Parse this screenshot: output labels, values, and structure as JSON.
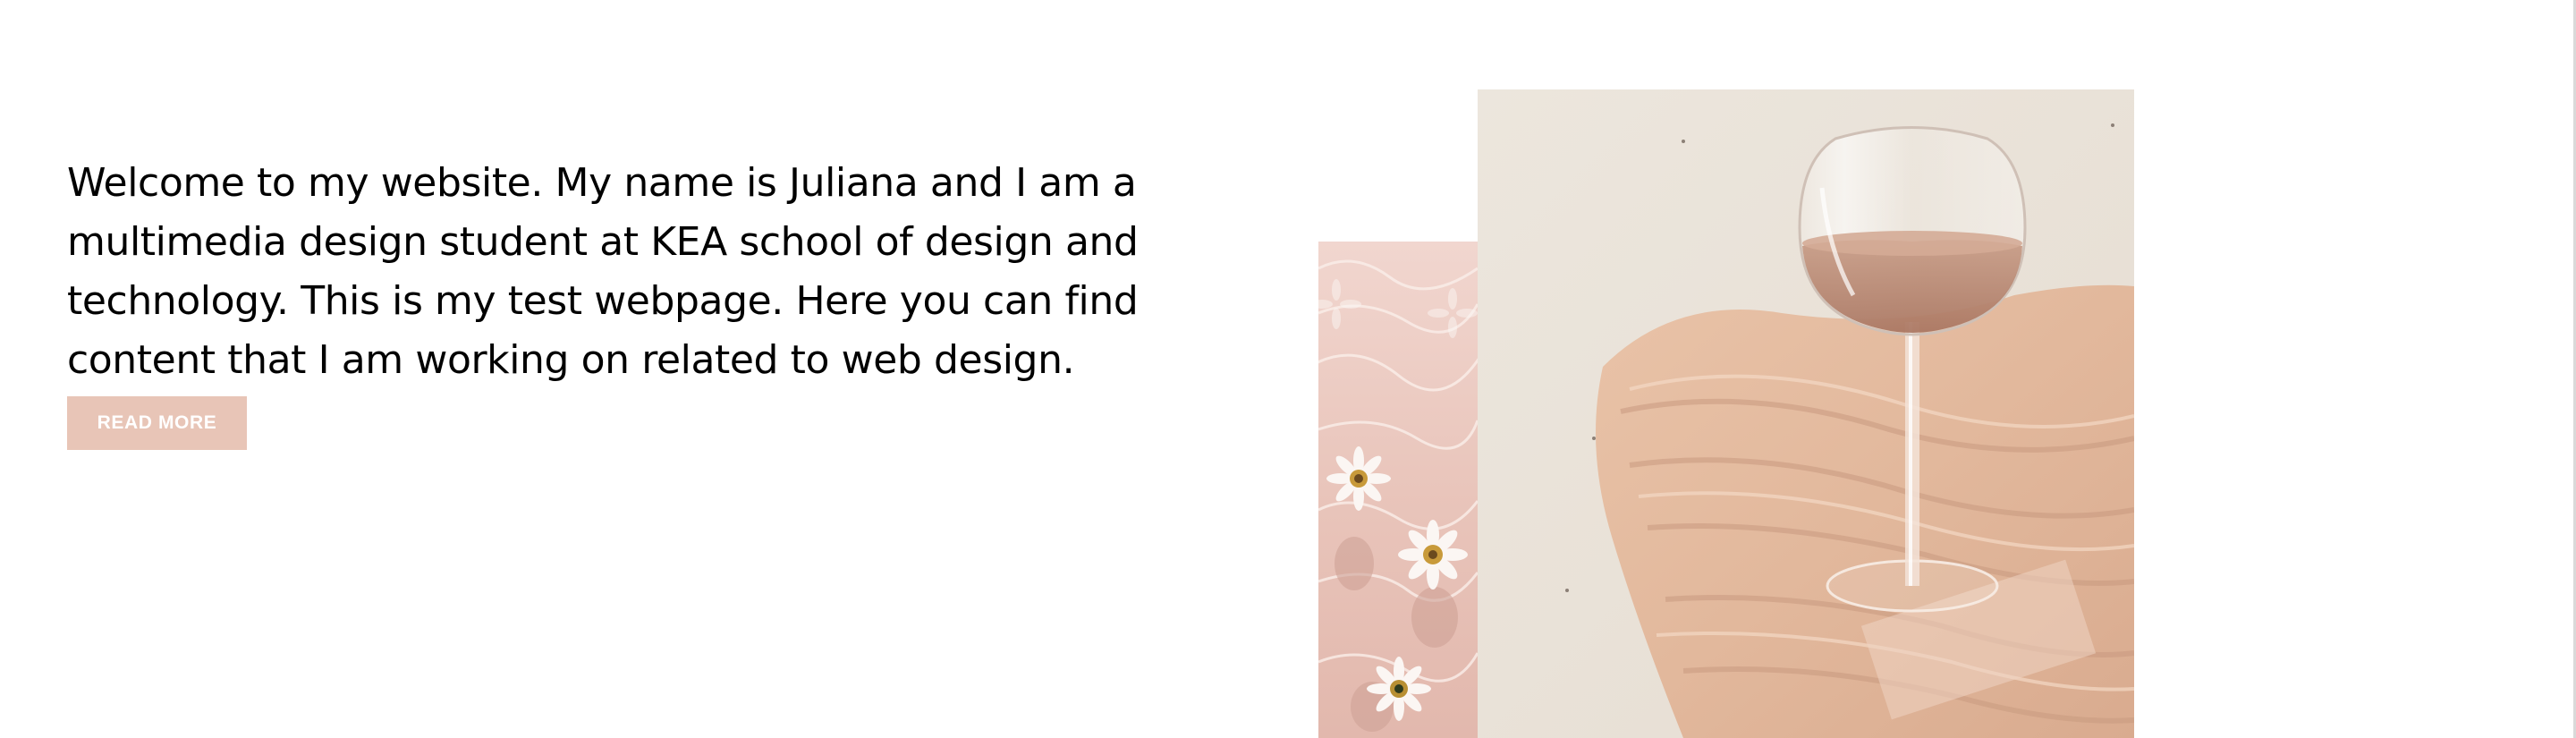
{
  "intro": {
    "text": "Welcome to my website. My name is Juliana and I am a multimedia design student at KEA school of design and technology. This is my test webpage. Here you can find content that I am working on related to web design."
  },
  "cta": {
    "label": "READ MORE"
  },
  "colors": {
    "button_bg": "#e8c5b7",
    "button_text": "#ffffff",
    "text": "#000000",
    "background": "#ffffff"
  },
  "images": {
    "small": "flowers-on-water-photo",
    "large": "wine-glass-on-silk-photo"
  }
}
